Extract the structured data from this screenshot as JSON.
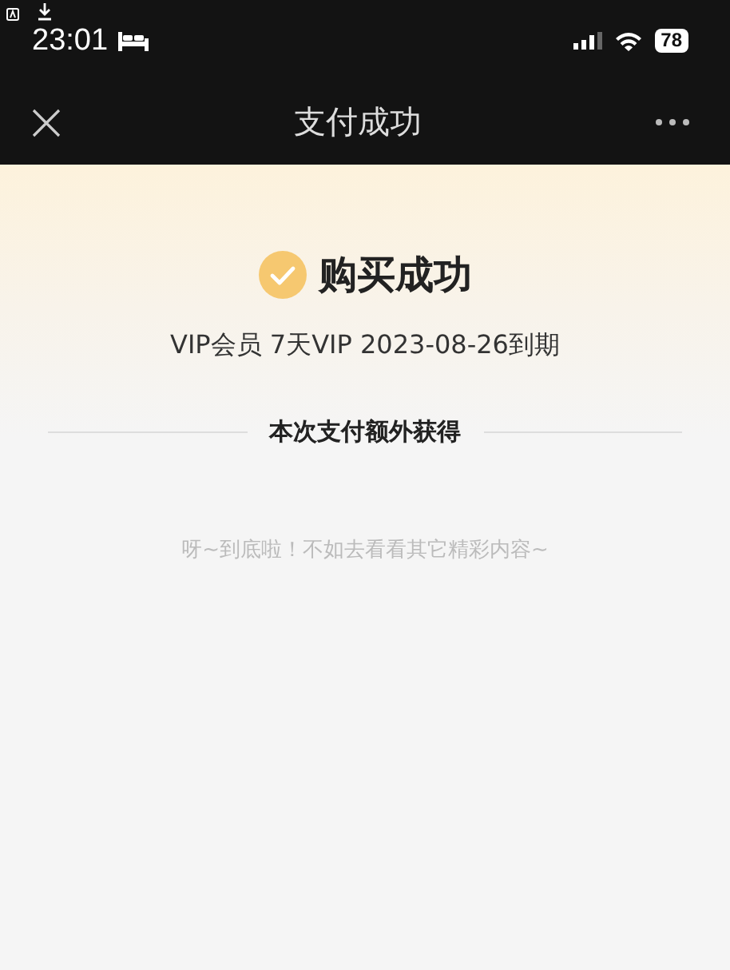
{
  "status_bar": {
    "time": "23:01",
    "battery": "78"
  },
  "nav": {
    "title": "支付成功"
  },
  "result": {
    "title": "购买成功",
    "detail": "VIP会员 7天VIP 2023-08-26到期"
  },
  "section": {
    "title": "本次支付额外获得"
  },
  "empty_message": "呀~到底啦！不如去看看其它精彩内容~"
}
